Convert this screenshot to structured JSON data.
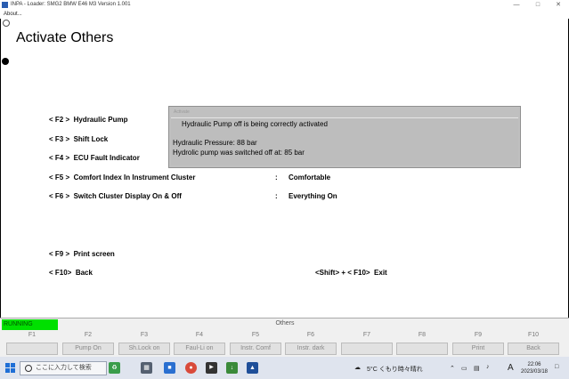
{
  "window": {
    "title": "INPA - Loader:  SMG2 BMW E46 M3 Version 1.001",
    "menu_about": "About..."
  },
  "page": {
    "title": "Activate Others"
  },
  "menu_items": [
    {
      "key": "< F2 >",
      "label": "Hydraulic Pump"
    },
    {
      "key": "< F3 >",
      "label": "Shift Lock"
    },
    {
      "key": "< F4 >",
      "label": "ECU Fault Indicator"
    },
    {
      "key": "< F5 >",
      "label": "Comfort Index In Instrument Cluster",
      "separator": ":",
      "value": "Comfortable"
    },
    {
      "key": "< F6 >",
      "label": "Switch Cluster Display On & Off",
      "separator": ":",
      "value": "Everything On"
    },
    {
      "key": "< F9 >",
      "label": "Print screen"
    },
    {
      "key": "< F10>",
      "label": "Back"
    }
  ],
  "exit_hint": {
    "key": "<Shift> + < F10>",
    "label": "Exit"
  },
  "dialog": {
    "title": "Activate",
    "message": "Hydraulic Pump off is being correctly activated",
    "line1": "Hydraulic Pressure: 88 bar",
    "line2": "Hydrolic pump was switched off at: 85 bar"
  },
  "status_panel": {
    "status": "RUNNING",
    "section": "Others"
  },
  "fkeys": [
    {
      "key": "F1",
      "label": ""
    },
    {
      "key": "F2",
      "label": "Pump On"
    },
    {
      "key": "F3",
      "label": "Sh.Lock on"
    },
    {
      "key": "F4",
      "label": "Faul-Li on"
    },
    {
      "key": "F5",
      "label": "Instr. Comf"
    },
    {
      "key": "F6",
      "label": "Instr. dark"
    },
    {
      "key": "F7",
      "label": ""
    },
    {
      "key": "F8",
      "label": ""
    },
    {
      "key": "F9",
      "label": "Print"
    },
    {
      "key": "F10",
      "label": "Back"
    }
  ],
  "taskbar": {
    "search_placeholder": "ここに入力して検索",
    "weather": "5°C  くもり時々晴れ",
    "ime": "A",
    "time": "22:06",
    "date": "2023/03/18"
  },
  "colors": {
    "status_green": "#00e000",
    "dialog_gray": "#c0c0c0"
  }
}
